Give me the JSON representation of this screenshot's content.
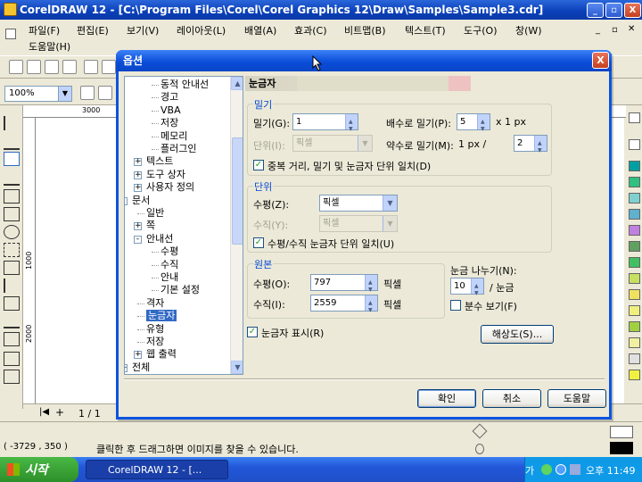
{
  "app": {
    "title": "CorelDRAW 12 - [C:\\Program Files\\Corel\\Corel Graphics 12\\Draw\\Samples\\Sample3.cdr]",
    "window_buttons": [
      "_",
      "▫",
      "X"
    ]
  },
  "menu": {
    "items": [
      "파일(F)",
      "편집(E)",
      "보기(V)",
      "레이아웃(L)",
      "배열(A)",
      "효과(C)",
      "비트맵(B)",
      "텍스트(T)",
      "도구(O)",
      "창(W)"
    ],
    "help": "도움말(H)"
  },
  "toolbar": {
    "zoom": "100%"
  },
  "ruler": {
    "top_label": "3000",
    "left_labels": [
      "1000",
      "2000"
    ],
    "unit": "픽셀"
  },
  "page": {
    "counter": "1 / 1"
  },
  "status": {
    "coords": "( -3729 , 350 )",
    "hint": "클릭한 후 드래그하면 이미지를 찾을 수 있습니다."
  },
  "taskbar": {
    "start": "시작",
    "task": "CorelDRAW 12 - [...",
    "tray_lang": "가",
    "time": "오후 11:49"
  },
  "dialog": {
    "title": "옵션",
    "close": "X",
    "tree": [
      {
        "label": "동적 안내선"
      },
      {
        "label": "경고"
      },
      {
        "label": "VBA"
      },
      {
        "label": "저장"
      },
      {
        "label": "메모리"
      },
      {
        "label": "플러그인"
      },
      {
        "label": "텍스트",
        "expander": "+"
      },
      {
        "label": "도구 상자",
        "expander": "+"
      },
      {
        "label": "사용자 정의",
        "expander": "+"
      },
      {
        "label": "문서",
        "expander": "-"
      },
      {
        "label": "일반"
      },
      {
        "label": "쪽",
        "expander": "+"
      },
      {
        "label": "안내선",
        "expander": "-"
      },
      {
        "label": "수평"
      },
      {
        "label": "수직"
      },
      {
        "label": "안내"
      },
      {
        "label": "기본 설정"
      },
      {
        "label": "격자"
      },
      {
        "label": "눈금자",
        "selected": true
      },
      {
        "label": "유형"
      },
      {
        "label": "저장"
      },
      {
        "label": "웹 출력",
        "expander": "+"
      },
      {
        "label": "전체",
        "expander": "+"
      }
    ],
    "panel_title": "눈금자",
    "nudge": {
      "group": "밀기",
      "nudge_label": "밀기(G):",
      "nudge_value": "1",
      "units_label": "단위(I):",
      "units_value": "픽셀",
      "super_nudge_label": "배수로 밀기(P):",
      "super_nudge_value": "5",
      "super_nudge_suffix": "x 1 px",
      "micro_nudge_label": "약수로 밀기(M):",
      "micro_nudge_prefix": "1 px /",
      "micro_nudge_value": "2",
      "match_label": "중복 거리, 밀기 및 눈금자 단위 일치(D)",
      "match_checked": "✓"
    },
    "units": {
      "group": "단위",
      "horizontal_label": "수평(Z):",
      "horizontal_value": "픽셀",
      "vertical_label": "수직(Y):",
      "vertical_value": "픽셀",
      "match_label": "수평/수직 눈금자 단위 일치(U)",
      "match_checked": "✓"
    },
    "origin": {
      "group": "원본",
      "horizontal_label": "수평(O):",
      "horizontal_value": "797",
      "horizontal_unit": "픽셀",
      "vertical_label": "수직(I):",
      "vertical_value": "2559",
      "vertical_unit": "픽셀"
    },
    "tick": {
      "label": "눈금 나누기(N):",
      "value": "10",
      "suffix": "/ 눈금",
      "fraction_label": "분수 보기(F)"
    },
    "show_rulers_label": "눈금자 표시(R)",
    "show_rulers_checked": "✓",
    "resolution_button": "해상도(S)...",
    "ok": "확인",
    "cancel": "취소",
    "help": "도움말"
  },
  "colors": {
    "titlebar": "#0a54e0",
    "selection": "#316ac5",
    "group_label": "#0046d5"
  }
}
